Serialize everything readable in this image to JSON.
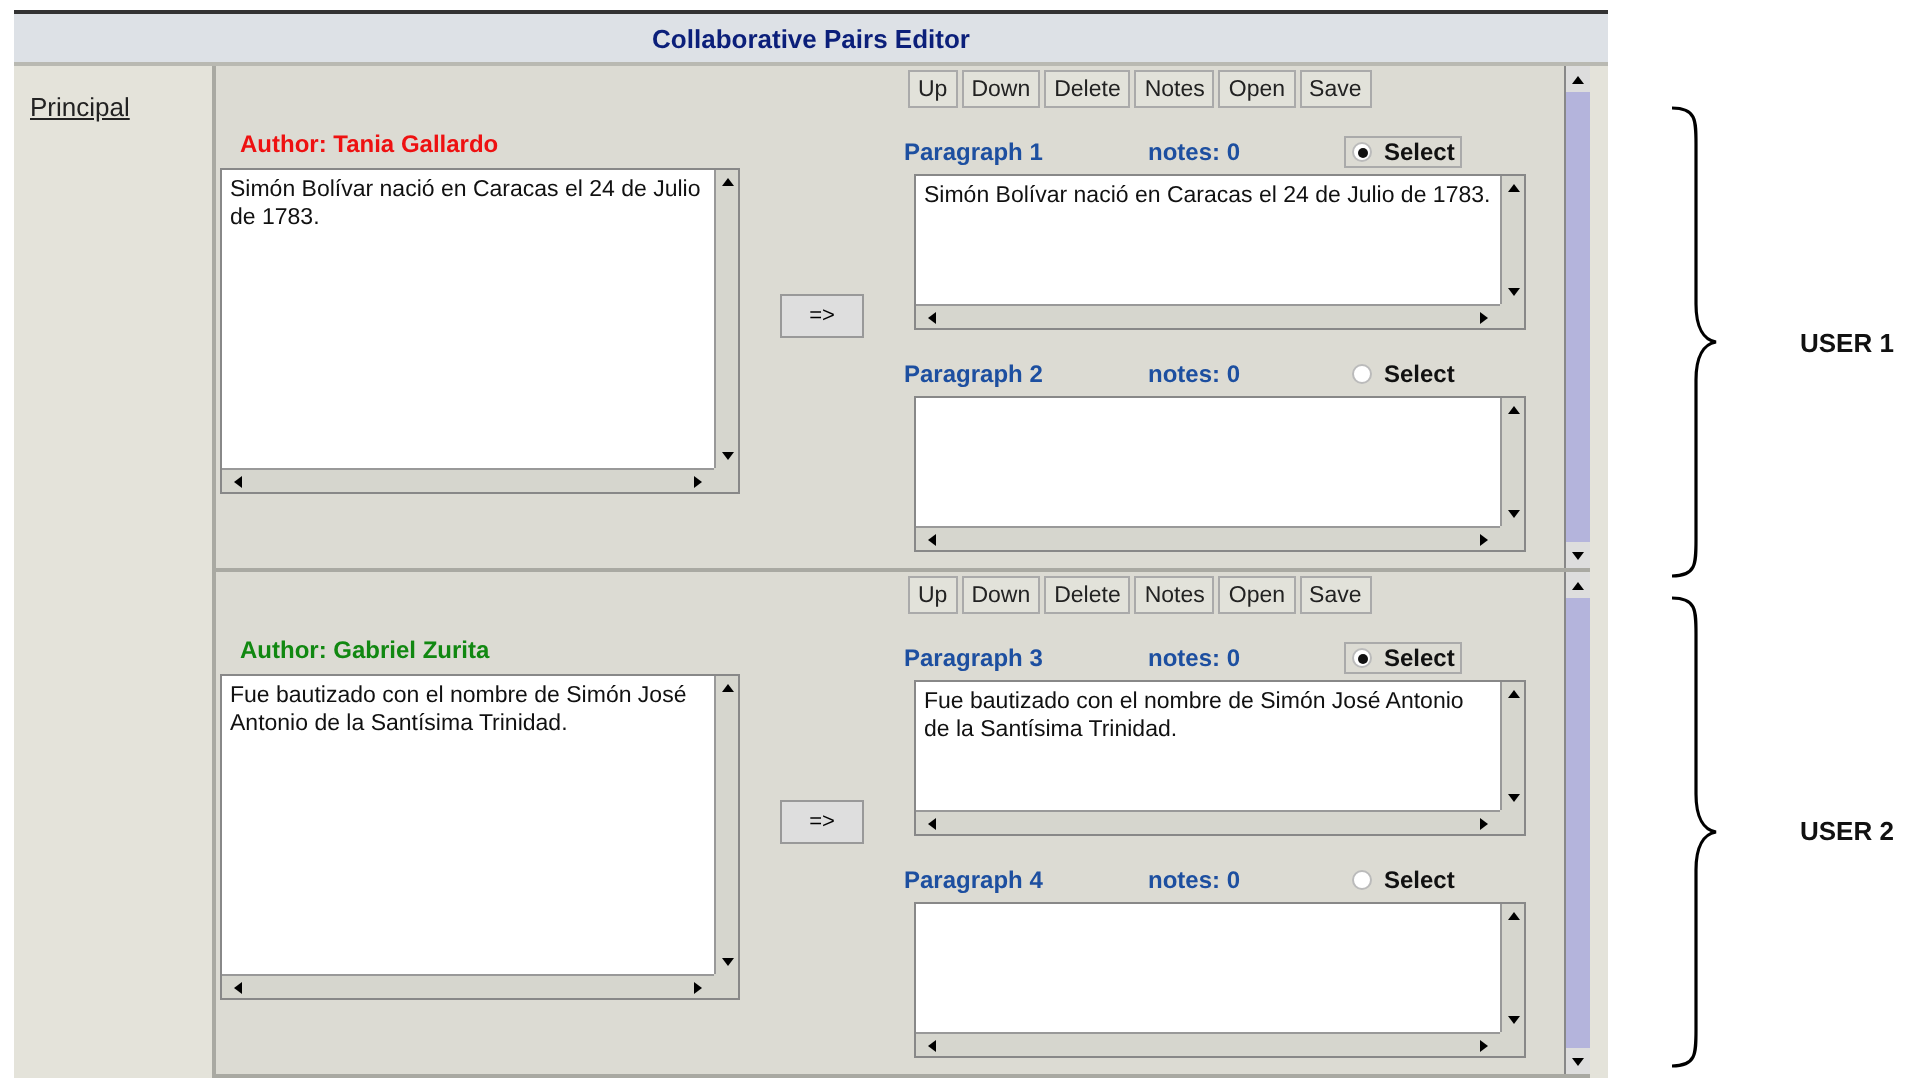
{
  "window": {
    "title": "Collaborative Pairs Editor"
  },
  "sidebar": {
    "link": "Principal"
  },
  "users": [
    {
      "author": "Author: Tania Gallardo",
      "color": "#ee1111",
      "draft": "Simón Bolívar nació en Caracas el 24 de Julio de 1783.",
      "transfer_button": "=>",
      "toolbar": [
        "Up",
        "Down",
        "Delete",
        "Notes",
        "Open",
        "Save"
      ],
      "paragraphs": [
        {
          "title": "Paragraph 1",
          "notes": "notes: 0",
          "select_label": "Select",
          "selected": true,
          "text": "Simón Bolívar nació en Caracas el 24 de Julio de 1783."
        },
        {
          "title": "Paragraph 2",
          "notes": "notes: 0",
          "select_label": "Select",
          "selected": false
        }
      ]
    },
    {
      "author": "Author: Gabriel Zurita",
      "color": "#118811",
      "draft": "Fue bautizado con el nombre de Simón José Antonio de la Santísima Trinidad.",
      "transfer_button": "=>",
      "toolbar": [
        "Up",
        "Down",
        "Delete",
        "Notes",
        "Open",
        "Save"
      ],
      "paragraphs": [
        {
          "title": "Paragraph 3",
          "notes": "notes: 0",
          "select_label": "Select",
          "selected": true,
          "text": "Fue bautizado con el nombre de Simón José Antonio de la Santísima Trinidad."
        },
        {
          "title": "Paragraph 4",
          "notes": "notes: 0",
          "select_label": "Select",
          "selected": false
        }
      ]
    }
  ],
  "annotations": [
    {
      "label": "USER 1"
    },
    {
      "label": "USER 2"
    }
  ]
}
